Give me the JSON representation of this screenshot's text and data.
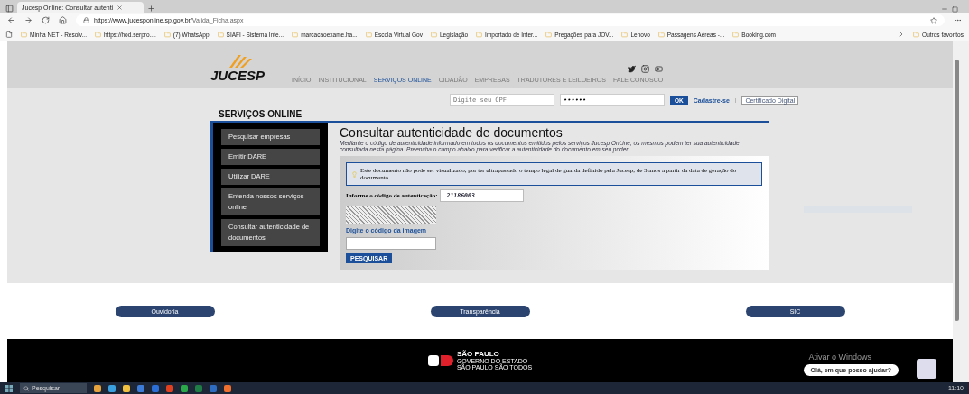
{
  "browser": {
    "tabs": [
      {
        "label": "Jucesp Online: Consultar autenti",
        "selected": true
      }
    ],
    "url_host": "https://www.jucesponline.sp.gov.br/",
    "url_path": "Valida_Ficha.aspx",
    "bookmarks": [
      "Minha NET - Resolv...",
      "https://hod.serpro....",
      "(7) WhatsApp",
      "SIAFI - Sistema Inte...",
      "marcacaoexame.ha...",
      "Escola Virtual Gov",
      "Legislação",
      "Importado de Inter...",
      "Pregações para JOV...",
      "Lenovo",
      "Passagens Aéreas -...",
      "Booking.com"
    ],
    "other_bookmarks": "Outros favoritos"
  },
  "header": {
    "logo": "JUCESP",
    "nav": [
      {
        "label": "INÍCIO",
        "selected": false
      },
      {
        "label": "INSTITUCIONAL",
        "selected": false
      },
      {
        "label": "SERVIÇOS ONLINE",
        "selected": true
      },
      {
        "label": "CIDADÃO",
        "selected": false
      },
      {
        "label": "EMPRESAS",
        "selected": false
      },
      {
        "label": "TRADUTORES E LEILOEIROS",
        "selected": false
      },
      {
        "label": "FALE CONOSCO",
        "selected": false
      }
    ]
  },
  "login": {
    "cpf_placeholder": "Digite seu CPF",
    "password_value": "••••••",
    "ok": "OK",
    "register": "Cadastre-se",
    "separator": "|",
    "certificate": "Certificado Digital"
  },
  "section_title": "SERVIÇOS ONLINE",
  "sidebar": [
    "Pesquisar empresas",
    "Emitir DARE",
    "Utilizar DARE",
    "Entenda nossos serviços online",
    "Consultar autenticidade de documentos"
  ],
  "content": {
    "title": "Consultar autenticidade de documentos",
    "intro": "Mediante o código de autenticidade informado em todos os documentos emitidos pelos serviços Jucesp OnLine, os mesmos podem ter sua autenticidade consultada nesta página. Preencha o campo abaixo para verificar a autenticidade do documento em seu poder.",
    "alert": "Este documento não pode ser visualizado, por ter ultrapassado o tempo legal de guarda definido pela Jucesp, de 3 anos a partir da data de geração do documento.",
    "code_label": "Informe o código de autenticação:",
    "code_value": "21186003",
    "captcha_label": "Digite o código da imagem",
    "search": "PESQUISAR"
  },
  "footer_links": [
    "Ouvidoria",
    "Transparência",
    "SIC"
  ],
  "footer": {
    "brand": "SÃO PAULO",
    "brand_sub": "GOVERNO DO ESTADO",
    "brand_tag": "SÃO PAULO SÃO TODOS",
    "chat": "Olá, em que posso ajudar?"
  },
  "windows_notice": "Ativar o Windows",
  "taskbar": {
    "search": "Pesquisar",
    "time": "11:10"
  }
}
